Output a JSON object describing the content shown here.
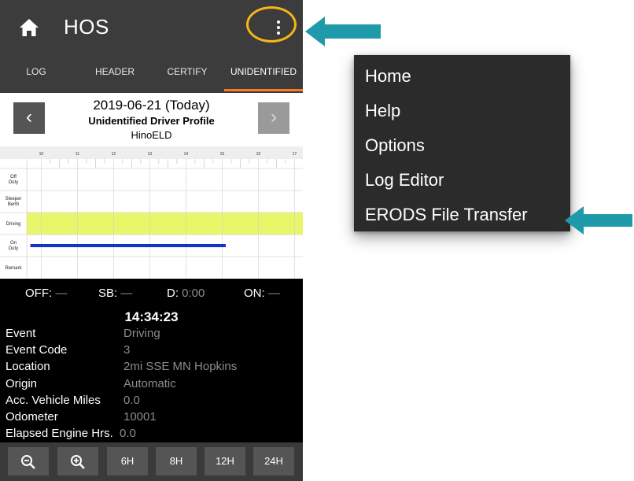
{
  "app": {
    "title": "HOS",
    "tabs": [
      "LOG",
      "HEADER",
      "CERTIFY",
      "UNIDENTIFIED"
    ],
    "active_tab": "UNIDENTIFIED"
  },
  "header": {
    "date": "2019-06-21 (Today)",
    "profile": "Unidentified Driver Profile",
    "device": "HinoELD"
  },
  "graph": {
    "hour_labels": [
      "10",
      "11",
      "12",
      "13",
      "14",
      "15",
      "16",
      "17"
    ],
    "rows": [
      "Off Duty",
      "Sleeper Berth",
      "Driving",
      "On Duty",
      "Remark"
    ],
    "highlight_row": "Driving",
    "highlight_color": "#e8f76a",
    "line_color": "#1235c9",
    "on_duty_line": {
      "start_hour": 9.7,
      "end_hour": 15.1
    },
    "hour_range": [
      9.6,
      17.1
    ]
  },
  "stats": {
    "off_label": "OFF:",
    "off_value": "—",
    "sb_label": "SB:",
    "sb_value": "—",
    "d_label": "D:",
    "d_value": "0:00",
    "on_label": "ON:",
    "on_value": "—"
  },
  "event_time": "14:34:23",
  "details": [
    {
      "key": "Event",
      "value": "Driving"
    },
    {
      "key": "Event Code",
      "value": "3"
    },
    {
      "key": "Location",
      "value": "2mi SSE MN Hopkins"
    },
    {
      "key": "Origin",
      "value": "Automatic"
    },
    {
      "key": "Acc. Vehicle Miles",
      "value": "0.0"
    },
    {
      "key": "Odometer",
      "value": "10001"
    },
    {
      "key": "Elapsed Engine Hrs.",
      "value": "0.0"
    }
  ],
  "zoom_buttons": [
    "6H",
    "8H",
    "12H",
    "24H"
  ],
  "menu": {
    "items": [
      "Home",
      "Help",
      "Options",
      "Log Editor",
      "ERODS File Transfer"
    ]
  },
  "colors": {
    "appbar": "#3c3c3c",
    "accent_tab": "#ff7a1f",
    "callout_ring": "#f5b718",
    "arrow": "#1e9aab",
    "menu_bg": "#2b2b2b"
  },
  "icons": [
    "home-icon",
    "more-vert-icon",
    "chevron-left-icon",
    "chevron-right-icon",
    "zoom-out-icon",
    "zoom-in-icon",
    "arrow-icon"
  ]
}
